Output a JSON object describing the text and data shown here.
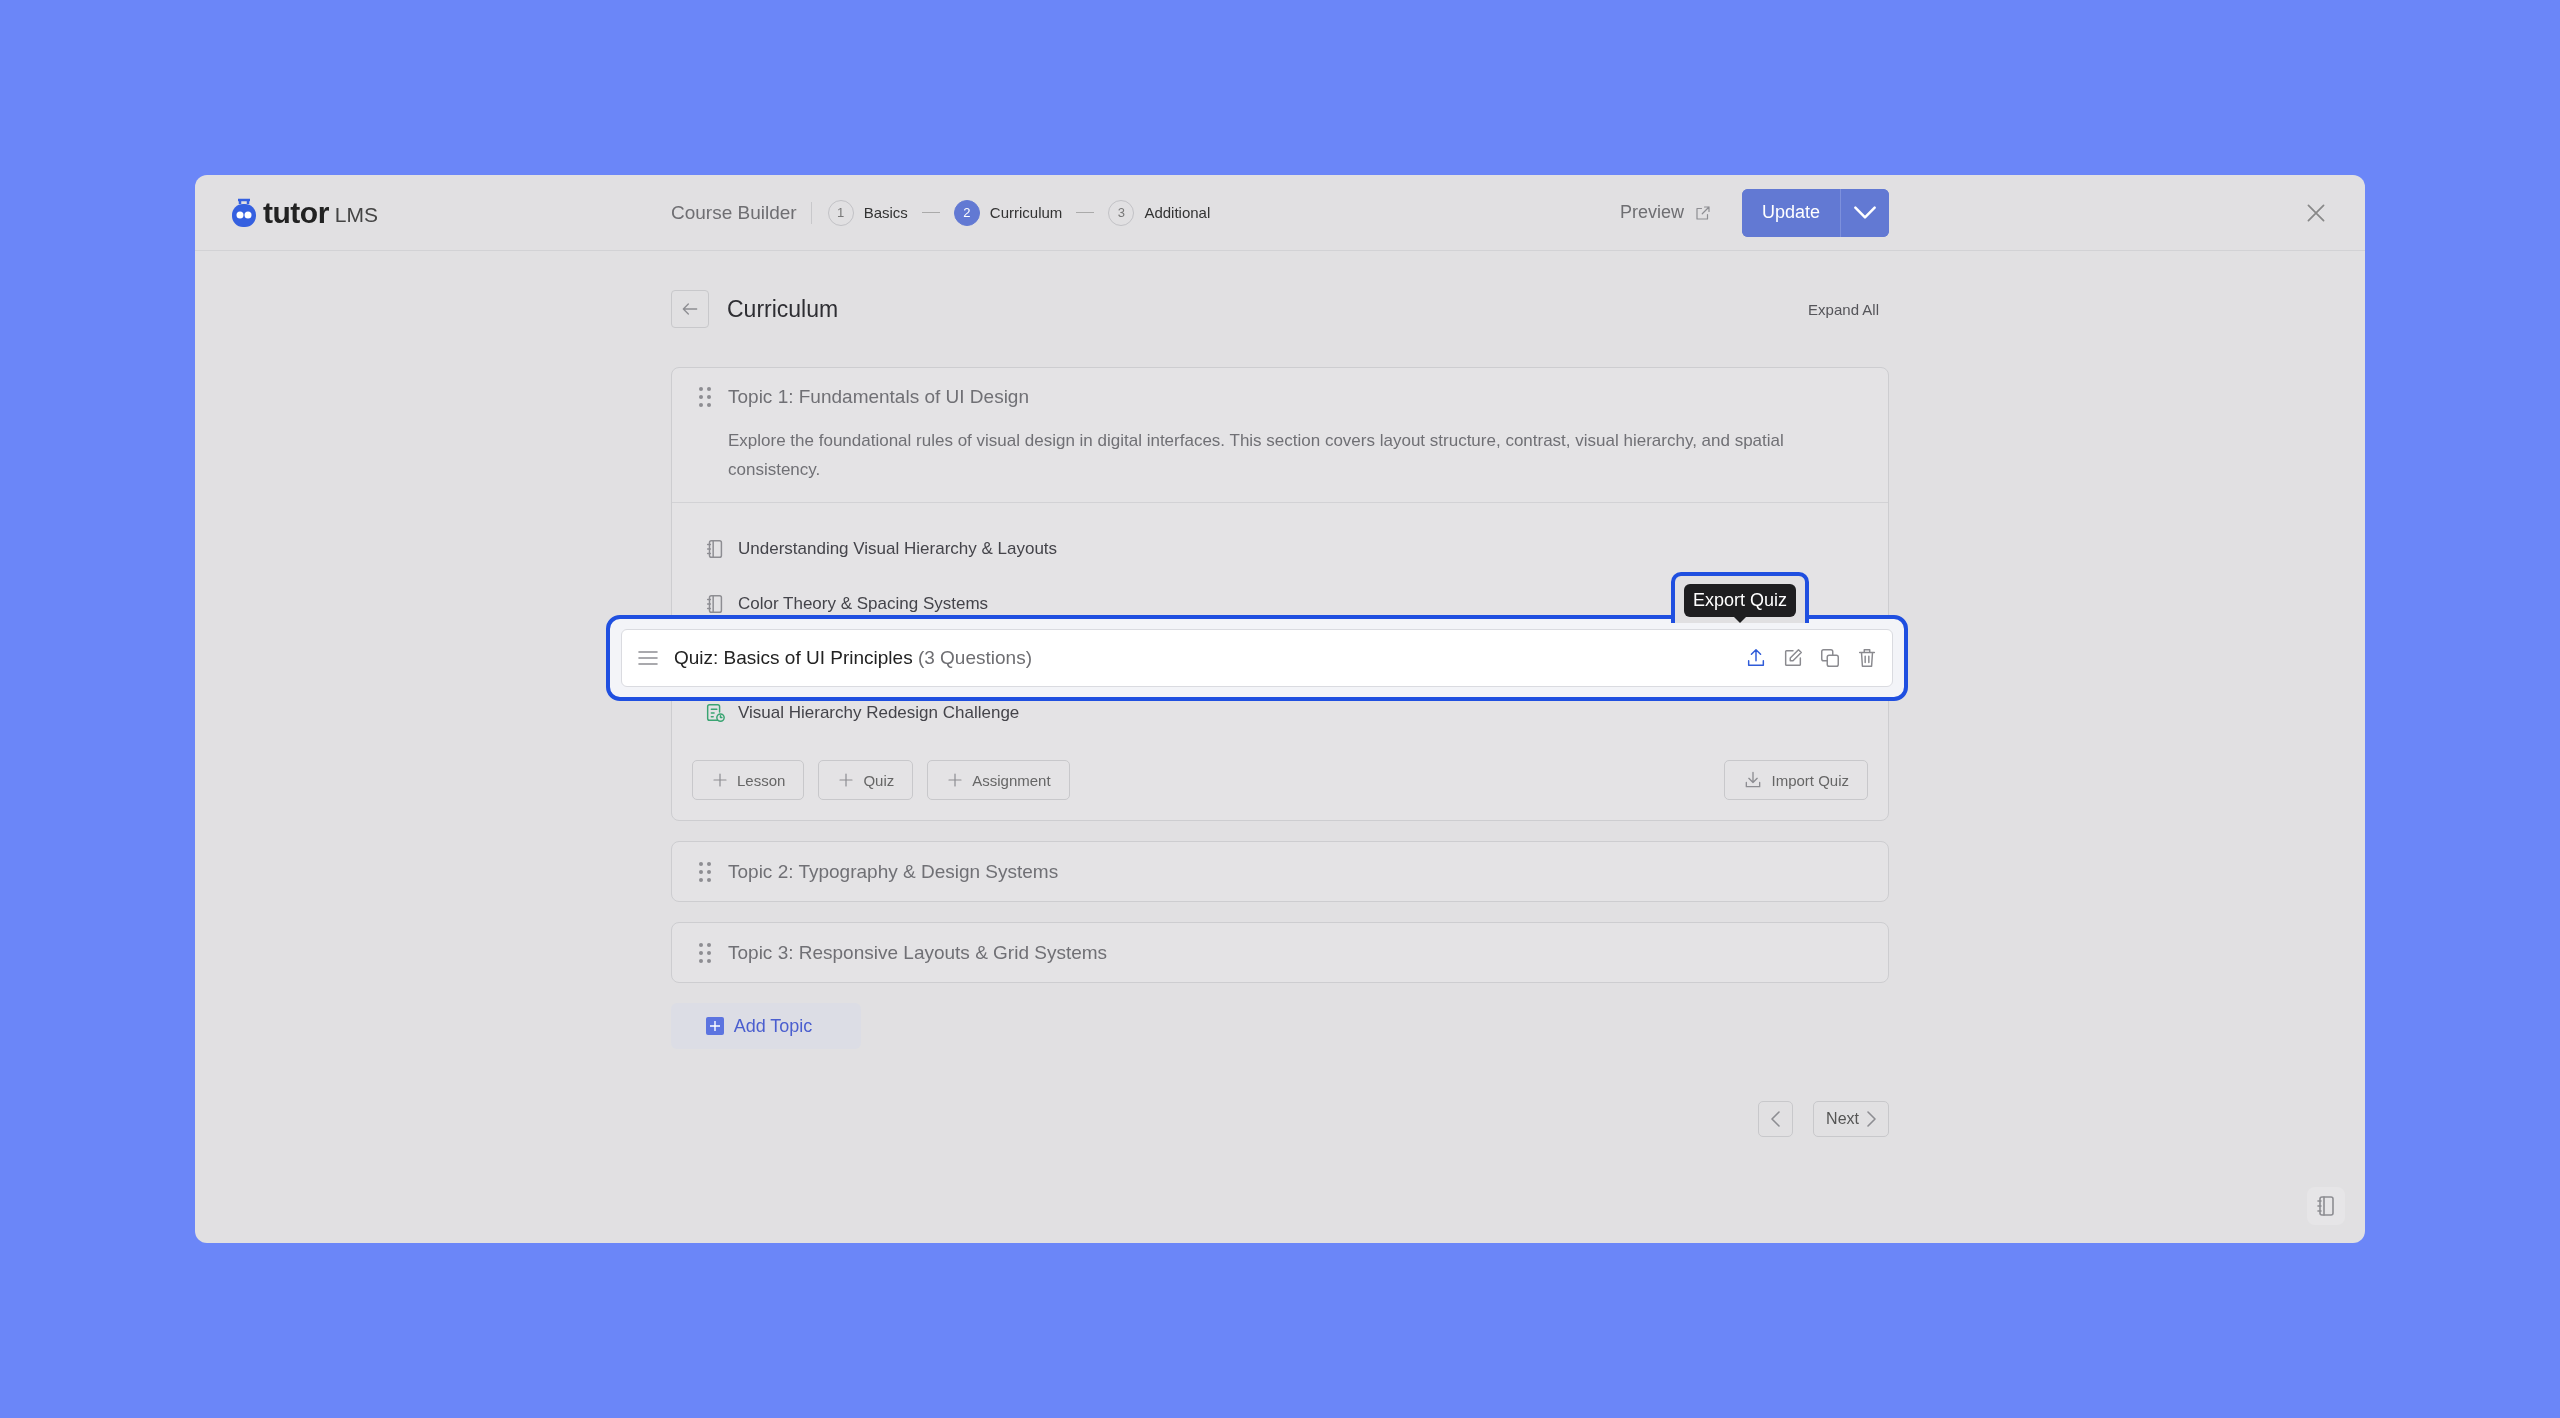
{
  "header": {
    "logo": {
      "word": "tutor",
      "suffix": "LMS"
    },
    "title": "Course Builder",
    "steps": [
      {
        "number": "1",
        "label": "Basics",
        "selected": false
      },
      {
        "number": "2",
        "label": "Curriculum",
        "selected": true
      },
      {
        "number": "3",
        "label": "Additional",
        "selected": false
      }
    ],
    "preview": "Preview",
    "update_button": "Update"
  },
  "page": {
    "title": "Curriculum",
    "expand_all": "Expand All"
  },
  "topics": [
    {
      "title": "Topic 1: Fundamentals of UI Design",
      "expanded": true,
      "description": "Explore the foundational rules of visual design in digital interfaces. This section covers layout structure, contrast, visual hierarchy, and spatial consistency.",
      "items": [
        {
          "kind": "lesson",
          "title": "Understanding Visual Hierarchy & Layouts"
        },
        {
          "kind": "lesson",
          "title": "Color Theory & Spacing Systems"
        },
        {
          "kind": "quiz",
          "title": "Quiz: Basics of UI Principles",
          "count": "(3 Questions)",
          "tooltip": "Export Quiz"
        },
        {
          "kind": "assignment",
          "title": "Visual Hierarchy Redesign Challenge"
        }
      ],
      "add_buttons": [
        "Lesson",
        "Quiz",
        "Assignment"
      ],
      "import_button": "Import Quiz"
    },
    {
      "title": "Topic 2: Typography & Design Systems",
      "expanded": false
    },
    {
      "title": "Topic 3: Responsive Layouts & Grid Systems",
      "expanded": false
    }
  ],
  "add_topic": "Add Topic",
  "pagination": {
    "next": "Next"
  }
}
